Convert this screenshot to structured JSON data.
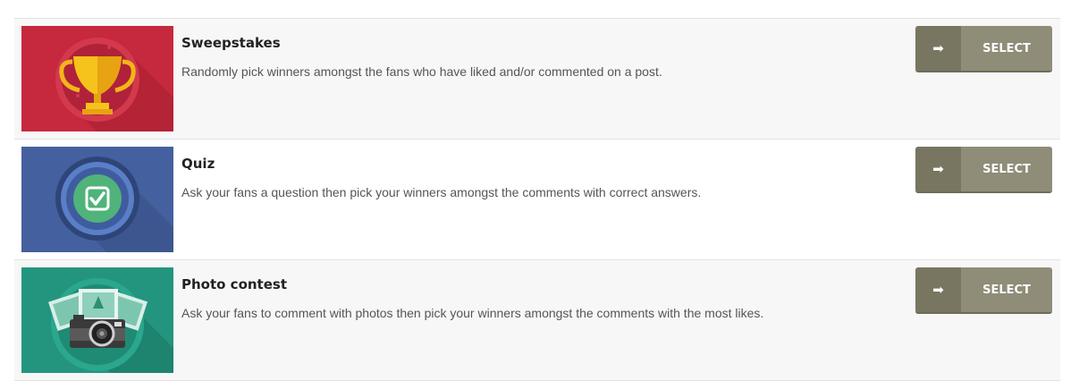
{
  "items": [
    {
      "title": "Sweepstakes",
      "description": "Randomly pick winners amongst the fans who have liked and/or commented on a post.",
      "button_label": "SELECT",
      "icon": "trophy-icon",
      "color": "#c6283d"
    },
    {
      "title": "Quiz",
      "description": "Ask your fans a question then pick your winners amongst the comments with correct answers.",
      "button_label": "SELECT",
      "icon": "checkmark-icon",
      "color": "#45609f"
    },
    {
      "title": "Photo contest",
      "description": "Ask your fans to comment with photos then pick your winners amongst the comments with the most likes.",
      "button_label": "SELECT",
      "icon": "camera-icon",
      "color": "#23957e"
    }
  ],
  "arrow_glyph": "➡"
}
